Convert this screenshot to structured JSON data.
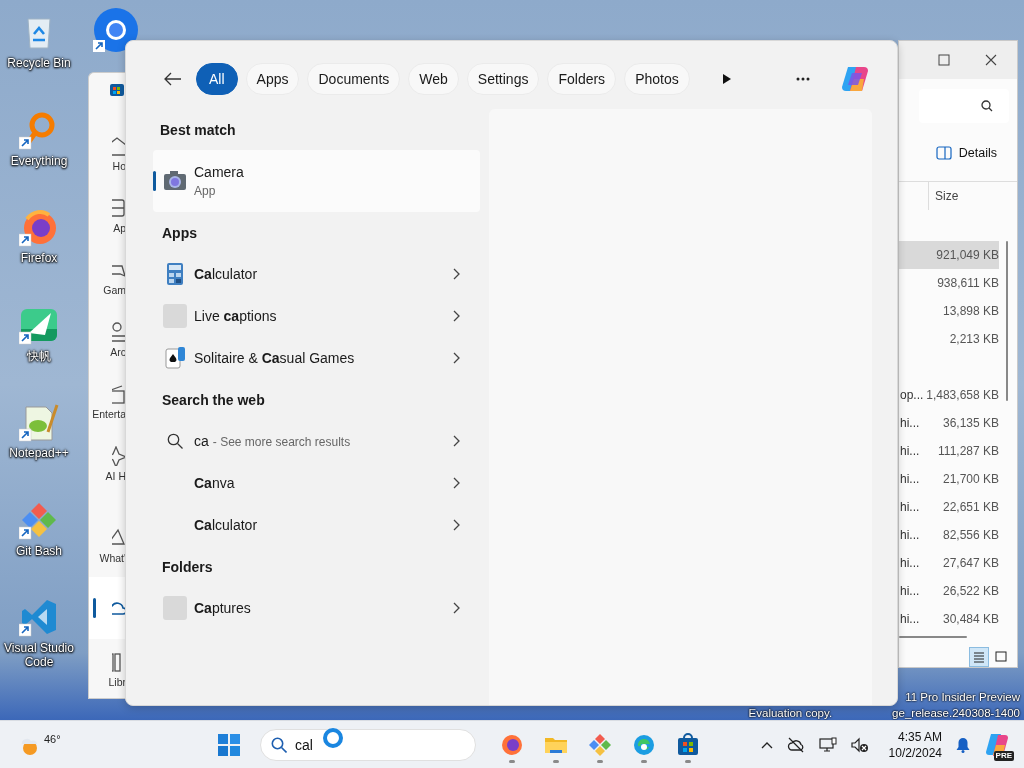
{
  "desktop_icons": [
    {
      "label": "Recycle Bin",
      "shortcut": false
    },
    {
      "label": "Everything",
      "shortcut": true
    },
    {
      "label": "Firefox",
      "shortcut": true
    },
    {
      "label": "快帆",
      "shortcut": true
    },
    {
      "label": "Notepad++",
      "shortcut": true
    },
    {
      "label": "Git Bash",
      "shortcut": true
    },
    {
      "label": "Visual Studio Code",
      "shortcut": true
    }
  ],
  "store_window": {
    "nav_items": [
      {
        "label": "Ho",
        "selected": false
      },
      {
        "label": "Ap",
        "selected": false
      },
      {
        "label": "Gam",
        "selected": false
      },
      {
        "label": "Arc",
        "selected": false
      },
      {
        "label": "Enterta",
        "selected": false
      },
      {
        "label": "AI H",
        "selected": false
      },
      {
        "label": "What'",
        "selected": false
      },
      {
        "selected": true
      },
      {
        "label": "Libr",
        "selected": false
      }
    ]
  },
  "explorer_window": {
    "details_button": "Details",
    "column_header": "Size",
    "rows": [
      {
        "kind": "folder"
      },
      {
        "kind": "file",
        "size": "921,049 KB",
        "selected": true
      },
      {
        "kind": "file",
        "size": "938,611 KB",
        "selected": false
      },
      {
        "kind": "file",
        "size": "13,898 KB",
        "selected": false
      },
      {
        "kind": "file",
        "size": "2,213 KB",
        "selected": false
      },
      {
        "kind": "folder"
      },
      {
        "kind": "file",
        "name": "op...",
        "size": "1,483,658 KB",
        "selected": false
      },
      {
        "kind": "file",
        "name": "hi...",
        "size": "36,135 KB",
        "selected": false
      },
      {
        "kind": "file",
        "name": "hi...",
        "size": "111,287 KB",
        "selected": false
      },
      {
        "kind": "file",
        "name": "hi...",
        "size": "21,700 KB",
        "selected": false
      },
      {
        "kind": "file",
        "name": "hi...",
        "size": "22,651 KB",
        "selected": false
      },
      {
        "kind": "file",
        "name": "hi...",
        "size": "82,556 KB",
        "selected": false
      },
      {
        "kind": "file",
        "name": "hi...",
        "size": "27,647 KB",
        "selected": false
      },
      {
        "kind": "file",
        "name": "hi...",
        "size": "26,522 KB",
        "selected": false
      },
      {
        "kind": "file",
        "name": "hi...",
        "size": "30,484 KB",
        "selected": false
      }
    ],
    "views": [
      {
        "kind": "details",
        "selected": true
      },
      {
        "kind": "tiles",
        "selected": false
      }
    ]
  },
  "search_panel": {
    "filters": [
      {
        "label": "All",
        "selected": true
      },
      {
        "label": "Apps",
        "selected": false
      },
      {
        "label": "Documents",
        "selected": false
      },
      {
        "label": "Web",
        "selected": false
      },
      {
        "label": "Settings",
        "selected": false
      },
      {
        "label": "Folders",
        "selected": false
      },
      {
        "label": "Photos",
        "selected": false
      }
    ],
    "sections": [
      {
        "heading": "Best match",
        "items": [
          {
            "kind": "best",
            "title": "Camera",
            "subtitle": "App",
            "selected": true
          }
        ]
      },
      {
        "heading": "Apps",
        "items": [
          {
            "kind": "app",
            "title": "**Ca**lculator",
            "selected": false
          },
          {
            "kind": "app",
            "title": "Live **ca**ptions",
            "selected": false
          },
          {
            "kind": "app",
            "title": "Solitaire & **Ca**sual Games",
            "selected": false
          }
        ]
      },
      {
        "heading": "Search the web",
        "items": [
          {
            "kind": "web",
            "title": "ca",
            "hint": "- See more search results",
            "selected": false
          },
          {
            "kind": "suggestion",
            "title": "**Ca**nva",
            "selected": false
          },
          {
            "kind": "suggestion",
            "title": "**Ca**lculator",
            "selected": false
          }
        ]
      },
      {
        "heading": "Folders",
        "items": [
          {
            "kind": "folder",
            "title": "**Ca**ptures",
            "selected": false
          }
        ]
      }
    ]
  },
  "taskbar": {
    "weather": "46°",
    "search_value": "cal",
    "pinned_apps": [
      {
        "running": true
      },
      {
        "running": true
      },
      {
        "running": true
      },
      {
        "running": true
      },
      {
        "running": true
      }
    ],
    "time": "4:35 AM",
    "date": "10/2/2024",
    "copilot_badge": "PRE"
  },
  "watermark": {
    "line_1": "11 Pro Insider Preview",
    "line_2a": "Evaluation copy.",
    "line_2b": "ge_release.240308-1400"
  }
}
